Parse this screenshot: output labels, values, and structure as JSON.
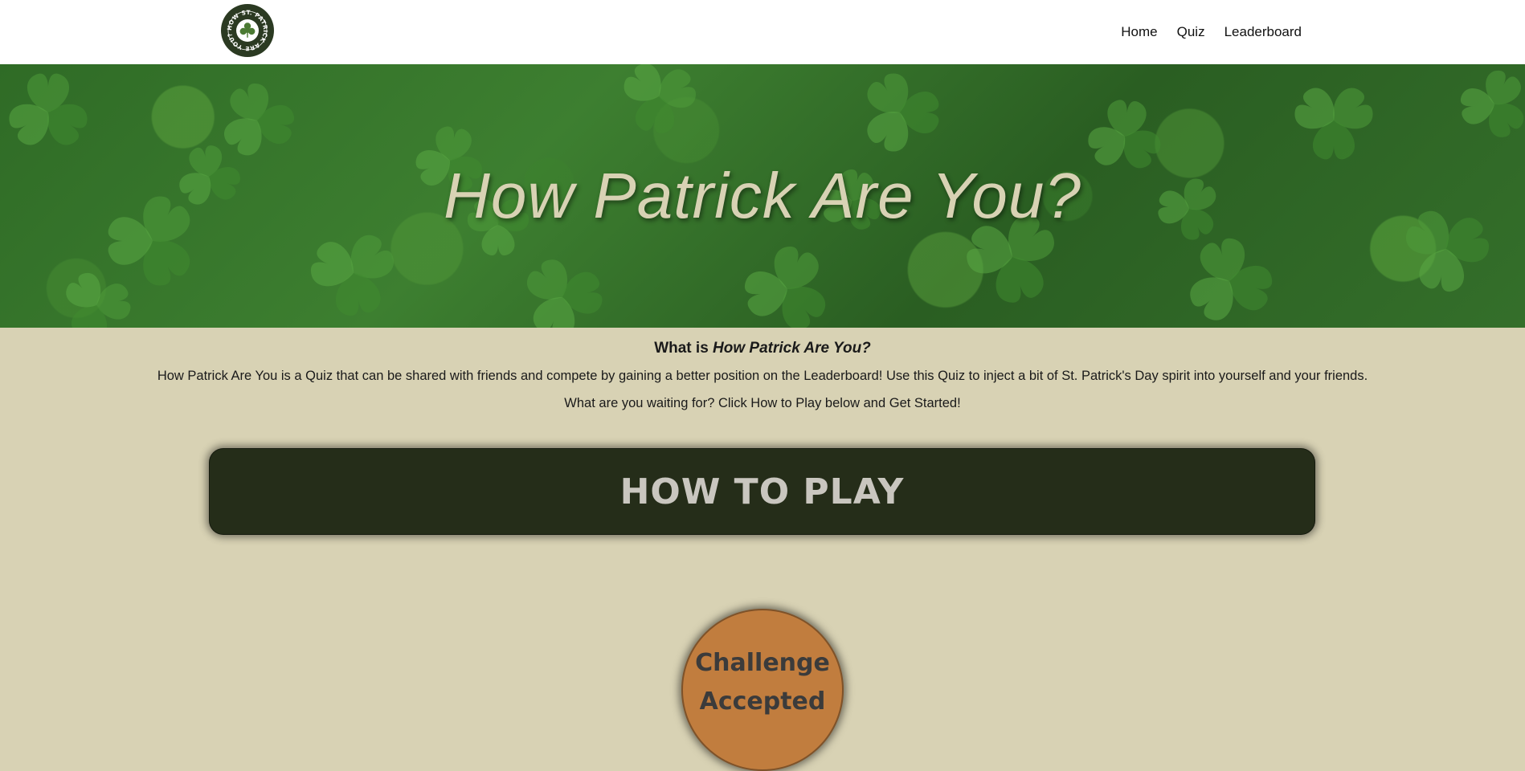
{
  "header": {
    "logo_text": "HOW ST. PATRICK ARE YOU?",
    "nav": [
      {
        "label": "Home"
      },
      {
        "label": "Quiz"
      },
      {
        "label": "Leaderboard"
      }
    ]
  },
  "hero": {
    "title": "How Patrick Are You?"
  },
  "about": {
    "heading_prefix": "What is",
    "heading_emphasis": "How Patrick Are You?",
    "paragraph1": "How Patrick Are You is a Quiz that can be shared with friends and compete by gaining a better position on the Leaderboard! Use this Quiz to inject a bit of St. Patrick's Day spirit into yourself and your friends.",
    "paragraph2": "What are you waiting for? Click How to Play below and Get Started!"
  },
  "how_to_play": {
    "label": "How to Play"
  },
  "challenge": {
    "line1": "Challenge",
    "line2": "Accepted"
  },
  "colors": {
    "header_bg": "#ffffff",
    "page_bg": "#d8d2b4",
    "howto_bg": "#252d19",
    "howto_text": "#c9c6bf",
    "challenge_bg": "#c17d3e",
    "hero_text": "#d8d2b4"
  }
}
